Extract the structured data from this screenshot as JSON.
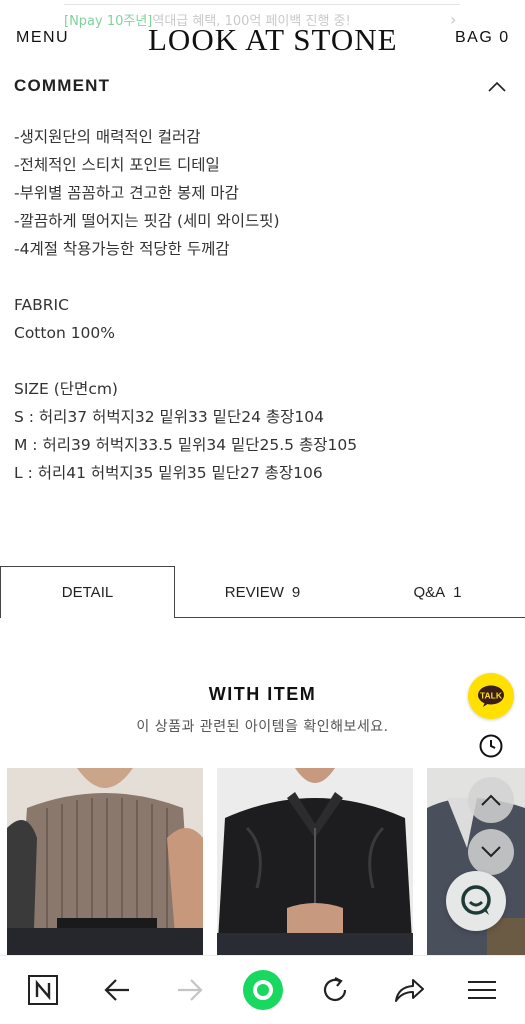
{
  "header": {
    "promo_highlight": "[Npay 10주년]",
    "promo_text": "역대급 혜택, 100억 페이백 진행 중!",
    "menu_label": "MENU",
    "logo_text": "LOOK AT STONE",
    "bag_label": "BAG",
    "bag_count": "0"
  },
  "comment": {
    "title": "COMMENT",
    "body": "-생지원단의 매력적인 컬러감\n-전체적인 스티치 포인트 디테일\n-부위별 꼼꼼하고 견고한 봉제 마감\n-깔끔하게 떨어지는 핏감 (세미 와이드핏)\n-4계절 착용가능한 적당한 두께감\n\nFABRIC\nCotton 100%\n\nSIZE (단면cm)\nS : 허리37 허벅지32 밑위33 밑단24 총장104\nM : 허리39 허벅지33.5 밑위34 밑단25.5 총장105\nL : 허리41 허벅지35 밑위35 밑단27 총장106"
  },
  "tabs": [
    {
      "label": "DETAIL",
      "count": ""
    },
    {
      "label": "REVIEW",
      "count": "9"
    },
    {
      "label": "Q&A",
      "count": "1"
    }
  ],
  "with_item": {
    "title": "WITH ITEM",
    "subtitle": "이 상품과 관련된 아이템을 확인해보세요."
  },
  "floating": {
    "kakao_label": "TALK"
  },
  "colors": {
    "kakao_yellow": "#ffe000",
    "active_green": "#18d860",
    "promo_green": "#7fd39a"
  },
  "icons": [
    "chevron-up-icon",
    "clock-icon",
    "arrow-up-icon",
    "arrow-down-icon",
    "chat-icon",
    "naver-n-icon",
    "back-arrow-icon",
    "forward-arrow-icon",
    "home-dot-icon",
    "reload-icon",
    "share-icon",
    "hamburger-icon"
  ]
}
